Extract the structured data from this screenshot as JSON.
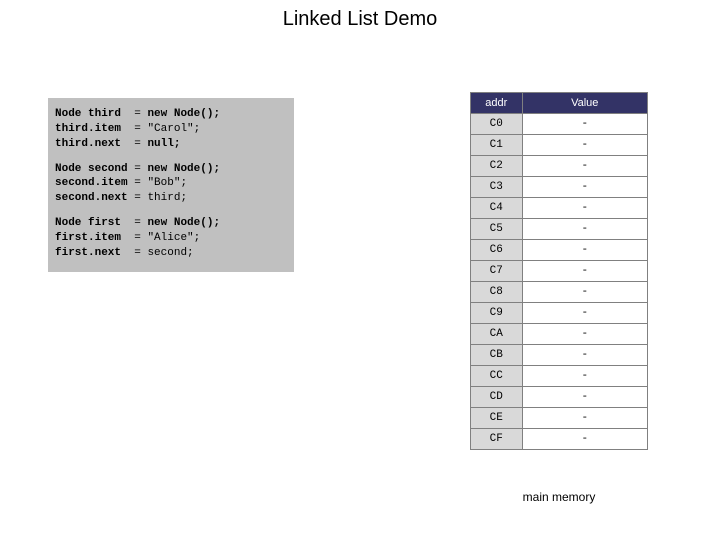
{
  "title": "Linked List Demo",
  "code": {
    "blocks": [
      {
        "lhs": [
          "Node third ",
          "third.item ",
          "third.next "
        ],
        "rhs": [
          "new Node();",
          "\"Carol\";",
          "null;"
        ],
        "rhs_kw": [
          true,
          false,
          true
        ]
      },
      {
        "lhs": [
          "Node second",
          "second.item",
          "second.next"
        ],
        "rhs": [
          "new Node();",
          "\"Bob\";",
          "third;"
        ],
        "rhs_kw": [
          true,
          false,
          false
        ]
      },
      {
        "lhs": [
          "Node first ",
          "first.item ",
          "first.next "
        ],
        "rhs": [
          "new Node();",
          "\"Alice\";",
          "second;"
        ],
        "rhs_kw": [
          true,
          false,
          false
        ]
      }
    ]
  },
  "memory": {
    "headers": {
      "addr": "addr",
      "value": "Value"
    },
    "rows": [
      {
        "addr": "C0",
        "value": "-"
      },
      {
        "addr": "C1",
        "value": "-"
      },
      {
        "addr": "C2",
        "value": "-"
      },
      {
        "addr": "C3",
        "value": "-"
      },
      {
        "addr": "C4",
        "value": "-"
      },
      {
        "addr": "C5",
        "value": "-"
      },
      {
        "addr": "C6",
        "value": "-"
      },
      {
        "addr": "C7",
        "value": "-"
      },
      {
        "addr": "C8",
        "value": "-"
      },
      {
        "addr": "C9",
        "value": "-"
      },
      {
        "addr": "CA",
        "value": "-"
      },
      {
        "addr": "CB",
        "value": "-"
      },
      {
        "addr": "CC",
        "value": "-"
      },
      {
        "addr": "CD",
        "value": "-"
      },
      {
        "addr": "CE",
        "value": "-"
      },
      {
        "addr": "CF",
        "value": "-"
      }
    ],
    "caption": "main memory"
  }
}
